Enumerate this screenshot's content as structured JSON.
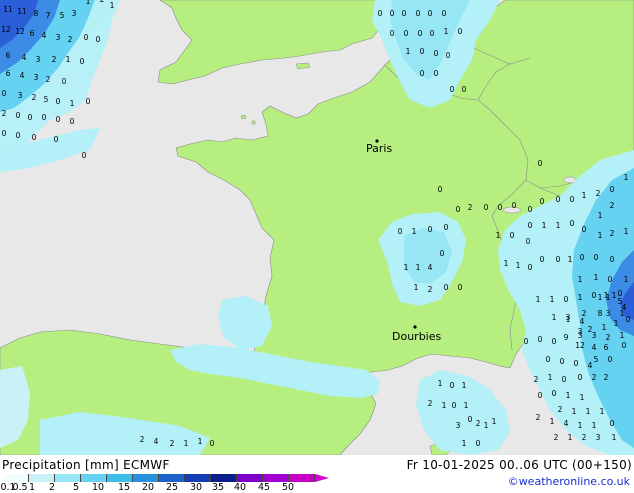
{
  "header": {
    "title": "Precipitation [mm] ECMWF",
    "valid": "Fr 10-01-2025 00..06 UTC (00+150)",
    "credit": "©weatheronline.co.uk"
  },
  "legend": {
    "labels": [
      "0.1",
      "0.5",
      "1",
      "2",
      "5",
      "10",
      "15",
      "20",
      "25",
      "30",
      "35",
      "40",
      "45",
      "50"
    ],
    "colors": [
      "#f2fdfd",
      "#c8f2f8",
      "#96e6f5",
      "#64d2f0",
      "#3cbeea",
      "#2891dc",
      "#1e64c8",
      "#143cb4",
      "#0a1e8c",
      "#7d00c8",
      "#a000d2",
      "#c800c8",
      "#dc00b4",
      "#d200d2"
    ]
  },
  "cities": [
    {
      "name": "Paris"
    },
    {
      "name": "Dourbies"
    }
  ],
  "colors": {
    "sea": "#e8e8e8",
    "land": "#b6ee80",
    "coast": "#8a8a8a",
    "precip_light": "#b4f0f8",
    "precip_med": "#64d2f0",
    "precip_heavy": "#3c8ce6",
    "precip_very_heavy": "#2a5fd8"
  },
  "map": {
    "grid_values": [
      "11",
      "11",
      "8",
      "7",
      "5",
      "3",
      "1",
      "2",
      "1",
      "12",
      "12",
      "6",
      "4",
      "3",
      "2",
      "0",
      "0",
      "6",
      "4",
      "3",
      "2",
      "1",
      "0",
      "6",
      "4",
      "3",
      "2",
      "0",
      "0",
      "3",
      "2",
      "5",
      "0",
      "1",
      "0",
      "2",
      "0",
      "0",
      "0",
      "0",
      "0",
      "0",
      "0",
      "0",
      "0",
      "0",
      "0",
      "0",
      "0",
      "0",
      "0",
      "0",
      "0",
      "0",
      "0",
      "0",
      "1",
      "0",
      "1",
      "0",
      "0",
      "0",
      "0",
      "0",
      "0",
      "0",
      "0",
      "0",
      "0",
      "2",
      "0",
      "0",
      "1",
      "0",
      "0",
      "1",
      "1",
      "4",
      "1",
      "2",
      "0",
      "0",
      "0",
      "0",
      "0",
      "0",
      "0",
      "0",
      "0",
      "1",
      "2",
      "0",
      "1",
      "2",
      "1",
      "0",
      "1",
      "1",
      "0",
      "0",
      "1",
      "0",
      "0",
      "1",
      "2",
      "1",
      "1",
      "1",
      "0",
      "0",
      "0",
      "1",
      "0",
      "0",
      "0",
      "1",
      "1",
      "0",
      "1",
      "0",
      "1",
      "0",
      "1",
      "1",
      "0",
      "1",
      "1",
      "2",
      "3",
      "1",
      "2",
      "1",
      "3",
      "3",
      "2",
      "1",
      "3",
      "4",
      "1",
      "0",
      "1",
      "5",
      "8",
      "1",
      "4",
      "0",
      "1",
      "1",
      "3",
      "4",
      "6",
      "0",
      "0",
      "0",
      "9",
      "12",
      "5",
      "0",
      "0",
      "0",
      "0",
      "4",
      "2",
      "2",
      "1",
      "0",
      "0",
      "2",
      "0",
      "0",
      "1",
      "1",
      "2",
      "1",
      "1",
      "1",
      "2",
      "1",
      "4",
      "1",
      "1",
      "0",
      "2",
      "1",
      "2",
      "3",
      "1",
      "1",
      "0",
      "1",
      "2",
      "1",
      "0",
      "1",
      "2",
      "0",
      "3",
      "1",
      "1",
      "1",
      "0",
      "2",
      "4",
      "2",
      "1",
      "1",
      "0",
      "0",
      "1",
      "1",
      "1",
      "0",
      "0",
      "0",
      "0",
      "0",
      "0",
      "0"
    ]
  }
}
